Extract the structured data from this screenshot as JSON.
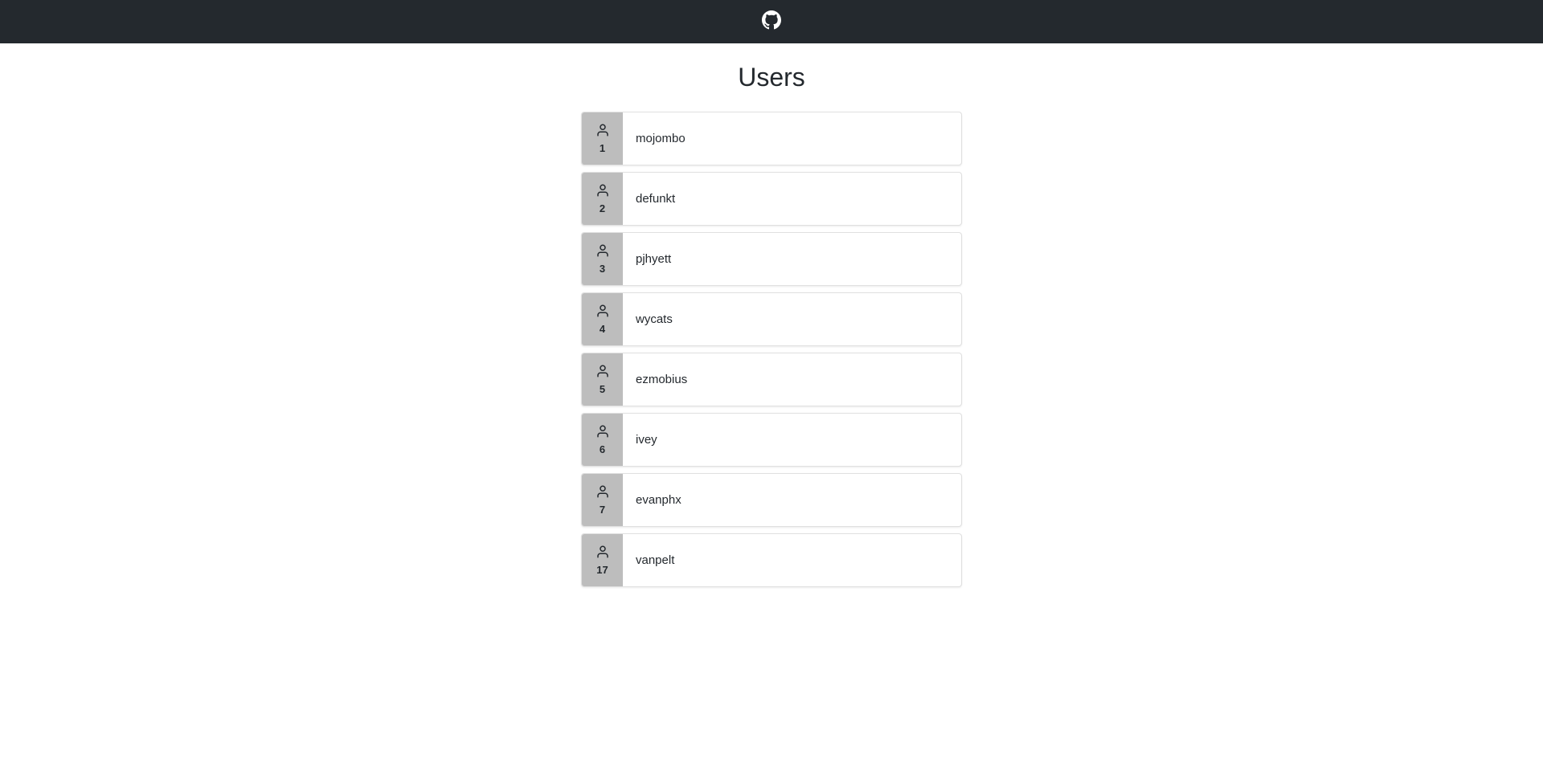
{
  "page": {
    "title": "Users"
  },
  "users": [
    {
      "id": "1",
      "login": "mojombo"
    },
    {
      "id": "2",
      "login": "defunkt"
    },
    {
      "id": "3",
      "login": "pjhyett"
    },
    {
      "id": "4",
      "login": "wycats"
    },
    {
      "id": "5",
      "login": "ezmobius"
    },
    {
      "id": "6",
      "login": "ivey"
    },
    {
      "id": "7",
      "login": "evanphx"
    },
    {
      "id": "17",
      "login": "vanpelt"
    }
  ]
}
